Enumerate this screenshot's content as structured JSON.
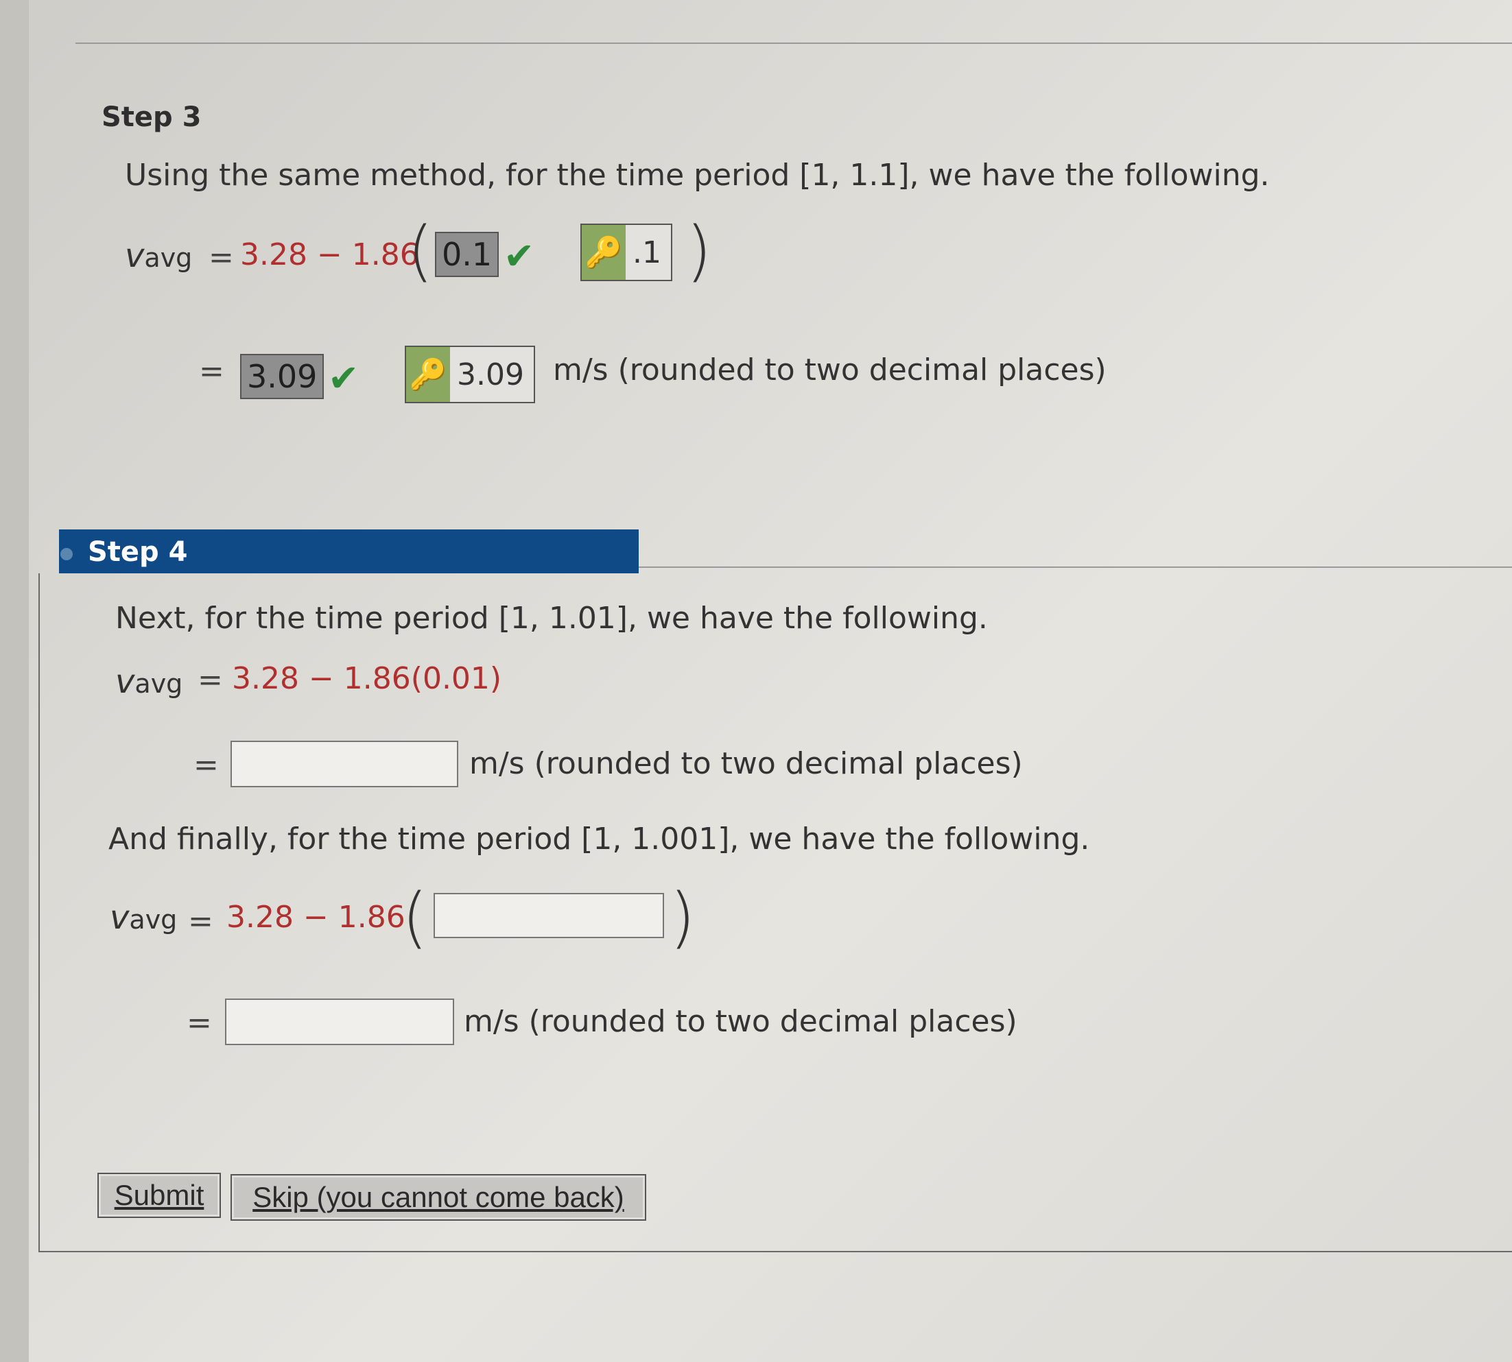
{
  "step3": {
    "title": "Step 3",
    "intro": "Using the same method, for the time period [1, 1.1], we have the following.",
    "v": "v",
    "v_sub": "avg",
    "eq": "=",
    "expr": "3.28 − 1.86",
    "paren_open": "(",
    "paren_close": ")",
    "answer1": "0.1",
    "key1": ".1",
    "answer2": "3.09",
    "key2": "3.09",
    "unit": "m/s (rounded to two decimal places)"
  },
  "step4": {
    "title": "Step 4",
    "intro1": "Next, for the time period [1, 1.01], we have the following.",
    "expr1": "3.28 − 1.86(0.01)",
    "unit": "m/s (rounded to two decimal places)",
    "intro2": "And finally, for the time period [1, 1.001], we have the following.",
    "expr2": "3.28 − 1.86",
    "inputs": {
      "v1": "",
      "h": "",
      "v2": ""
    }
  },
  "buttons": {
    "submit": "Submit",
    "skip": "Skip (you cannot come back)"
  },
  "icons": {
    "check": "✔",
    "key": "🔑"
  },
  "colors": {
    "accent_bar": "#0f4a86",
    "expr_red": "#b03030",
    "check_green": "#2e8b3a"
  }
}
